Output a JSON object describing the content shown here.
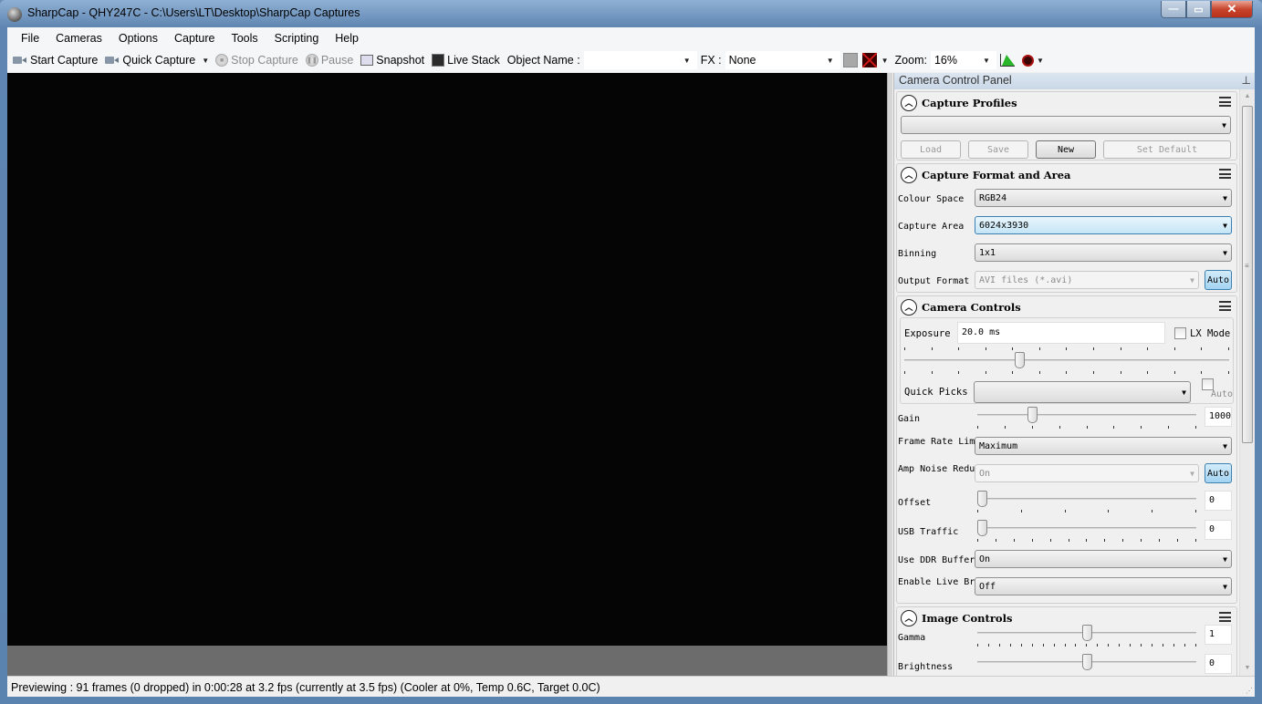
{
  "window": {
    "title": "SharpCap - QHY247C - C:\\Users\\LT\\Desktop\\SharpCap Captures",
    "minimize_label": "—",
    "maximize_label": "▭",
    "close_label": "✕"
  },
  "menubar": {
    "items": [
      {
        "label": "File"
      },
      {
        "label": "Cameras"
      },
      {
        "label": "Options"
      },
      {
        "label": "Capture"
      },
      {
        "label": "Tools"
      },
      {
        "label": "Scripting"
      },
      {
        "label": "Help"
      }
    ]
  },
  "toolbar": {
    "start_capture": "Start Capture",
    "quick_capture": "Quick Capture",
    "stop_capture": "Stop Capture",
    "pause": "Pause",
    "snapshot": "Snapshot",
    "live_stack": "Live Stack",
    "object_name_label": "Object Name :",
    "object_name_value": "",
    "fx_label": "FX :",
    "fx_value": "None",
    "zoom_label": "Zoom:",
    "zoom_value": "16%",
    "dropdown_arrow": "▼"
  },
  "status_bar": {
    "text": "Previewing : 91 frames (0 dropped) in 0:00:28 at 3.2 fps  (currently at 3.5 fps) (Cooler at 0%, Temp 0.6C, Target 0.0C)"
  },
  "panel": {
    "title": "Camera Control Panel",
    "pin_icon": "📌",
    "capture_profiles": {
      "title": "Capture Profiles",
      "profile_value": "",
      "buttons": {
        "load": "Load",
        "save": "Save",
        "new": "New",
        "set_default": "Set Default"
      }
    },
    "capture_format": {
      "title": "Capture Format and Area",
      "colour_space_label": "Colour Space",
      "colour_space_value": "RGB24",
      "capture_area_label": "Capture Area",
      "capture_area_value": "6024x3930",
      "binning_label": "Binning",
      "binning_value": "1x1",
      "output_format_label": "Output Format",
      "output_format_value": "AVI files (*.avi)",
      "auto_label": "Auto"
    },
    "camera_controls": {
      "title": "Camera Controls",
      "exposure_label": "Exposure",
      "exposure_value": "20.0 ms",
      "exposure_slider_fraction": 0.35,
      "lx_mode_label": "LX Mode",
      "lx_mode_checked": false,
      "quick_picks_label": "Quick Picks",
      "quick_picks_value": "",
      "quick_picks_auto_label": "Auto",
      "gain_label": "Gain",
      "gain_value": "1000",
      "gain_slider_fraction": 0.24,
      "frame_rate_label": "Frame Rate Limit",
      "frame_rate_value": "Maximum",
      "amp_noise_label": "Amp Noise Reduction",
      "amp_noise_value": "On",
      "amp_noise_auto_label": "Auto",
      "offset_label": "Offset",
      "offset_value": "0",
      "offset_slider_fraction": 0,
      "usb_traffic_label": "USB Traffic",
      "usb_traffic_value": "0",
      "usb_traffic_slider_fraction": 0,
      "ddr_buffer_label": "Use DDR Buffer",
      "ddr_buffer_value": "On",
      "live_broadcast_label": "Enable Live Broadcast",
      "live_broadcast_value": "Off"
    },
    "image_controls": {
      "title": "Image Controls",
      "gamma_label": "Gamma",
      "gamma_value": "1",
      "gamma_slider_fraction": 0.5,
      "brightness_label": "Brightness",
      "brightness_value": "0",
      "brightness_slider_fraction": 0.5
    }
  }
}
